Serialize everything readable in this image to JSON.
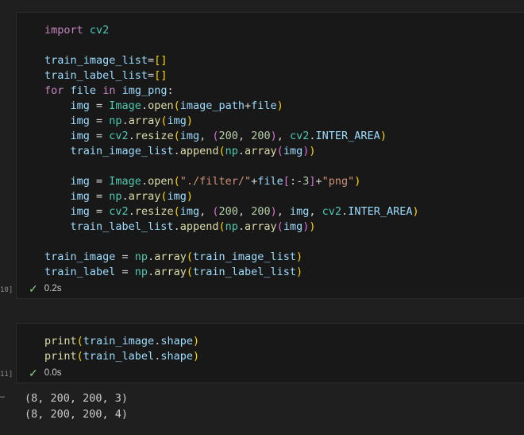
{
  "cells": [
    {
      "execution_label": "10]",
      "status": {
        "check_icon": "check-icon",
        "time": "0.2s"
      },
      "code_lines": [
        [
          [
            "kw",
            "import"
          ],
          [
            "op",
            " "
          ],
          [
            "mod",
            "cv2"
          ]
        ],
        [],
        [
          [
            "v",
            "train_image_list"
          ],
          [
            "op",
            "="
          ],
          [
            "p1",
            "[]"
          ]
        ],
        [
          [
            "v",
            "train_label_list"
          ],
          [
            "op",
            "="
          ],
          [
            "p1",
            "[]"
          ]
        ],
        [
          [
            "kw",
            "for"
          ],
          [
            "op",
            " "
          ],
          [
            "v",
            "file"
          ],
          [
            "op",
            " "
          ],
          [
            "kw",
            "in"
          ],
          [
            "op",
            " "
          ],
          [
            "v",
            "img_png"
          ],
          [
            "op",
            ":"
          ]
        ],
        [
          [
            "op",
            "    "
          ],
          [
            "v",
            "img"
          ],
          [
            "op",
            " = "
          ],
          [
            "cls",
            "Image"
          ],
          [
            "op",
            "."
          ],
          [
            "fn",
            "open"
          ],
          [
            "p1",
            "("
          ],
          [
            "v",
            "image_path"
          ],
          [
            "op",
            "+"
          ],
          [
            "v",
            "file"
          ],
          [
            "p1",
            ")"
          ]
        ],
        [
          [
            "op",
            "    "
          ],
          [
            "v",
            "img"
          ],
          [
            "op",
            " = "
          ],
          [
            "mod",
            "np"
          ],
          [
            "op",
            "."
          ],
          [
            "fn",
            "array"
          ],
          [
            "p1",
            "("
          ],
          [
            "v",
            "img"
          ],
          [
            "p1",
            ")"
          ]
        ],
        [
          [
            "op",
            "    "
          ],
          [
            "v",
            "img"
          ],
          [
            "op",
            " = "
          ],
          [
            "mod",
            "cv2"
          ],
          [
            "op",
            "."
          ],
          [
            "fn",
            "resize"
          ],
          [
            "p1",
            "("
          ],
          [
            "v",
            "img"
          ],
          [
            "op",
            ", "
          ],
          [
            "p2",
            "("
          ],
          [
            "num",
            "200"
          ],
          [
            "op",
            ", "
          ],
          [
            "num",
            "200"
          ],
          [
            "p2",
            ")"
          ],
          [
            "op",
            ", "
          ],
          [
            "mod",
            "cv2"
          ],
          [
            "op",
            "."
          ],
          [
            "v",
            "INTER_AREA"
          ],
          [
            "p1",
            ")"
          ]
        ],
        [
          [
            "op",
            "    "
          ],
          [
            "v",
            "train_image_list"
          ],
          [
            "op",
            "."
          ],
          [
            "fn",
            "append"
          ],
          [
            "p1",
            "("
          ],
          [
            "mod",
            "np"
          ],
          [
            "op",
            "."
          ],
          [
            "fn",
            "array"
          ],
          [
            "p2",
            "("
          ],
          [
            "v",
            "img"
          ],
          [
            "p2",
            ")"
          ],
          [
            "p1",
            ")"
          ]
        ],
        [],
        [
          [
            "op",
            "    "
          ],
          [
            "v",
            "img"
          ],
          [
            "op",
            " = "
          ],
          [
            "cls",
            "Image"
          ],
          [
            "op",
            "."
          ],
          [
            "fn",
            "open"
          ],
          [
            "p1",
            "("
          ],
          [
            "str",
            "\"./filter/\""
          ],
          [
            "op",
            "+"
          ],
          [
            "v",
            "file"
          ],
          [
            "p2",
            "["
          ],
          [
            "op",
            ":-"
          ],
          [
            "num",
            "3"
          ],
          [
            "p2",
            "]"
          ],
          [
            "op",
            "+"
          ],
          [
            "str",
            "\"png\""
          ],
          [
            "p1",
            ")"
          ]
        ],
        [
          [
            "op",
            "    "
          ],
          [
            "v",
            "img"
          ],
          [
            "op",
            " = "
          ],
          [
            "mod",
            "np"
          ],
          [
            "op",
            "."
          ],
          [
            "fn",
            "array"
          ],
          [
            "p1",
            "("
          ],
          [
            "v",
            "img"
          ],
          [
            "p1",
            ")"
          ]
        ],
        [
          [
            "op",
            "    "
          ],
          [
            "v",
            "img"
          ],
          [
            "op",
            " = "
          ],
          [
            "mod",
            "cv2"
          ],
          [
            "op",
            "."
          ],
          [
            "fn",
            "resize"
          ],
          [
            "p1",
            "("
          ],
          [
            "v",
            "img"
          ],
          [
            "op",
            ", "
          ],
          [
            "p2",
            "("
          ],
          [
            "num",
            "200"
          ],
          [
            "op",
            ", "
          ],
          [
            "num",
            "200"
          ],
          [
            "p2",
            ")"
          ],
          [
            "op",
            ", "
          ],
          [
            "v",
            "img"
          ],
          [
            "op",
            ", "
          ],
          [
            "mod",
            "cv2"
          ],
          [
            "op",
            "."
          ],
          [
            "v",
            "INTER_AREA"
          ],
          [
            "p1",
            ")"
          ]
        ],
        [
          [
            "op",
            "    "
          ],
          [
            "v",
            "train_label_list"
          ],
          [
            "op",
            "."
          ],
          [
            "fn",
            "append"
          ],
          [
            "p1",
            "("
          ],
          [
            "mod",
            "np"
          ],
          [
            "op",
            "."
          ],
          [
            "fn",
            "array"
          ],
          [
            "p2",
            "("
          ],
          [
            "v",
            "img"
          ],
          [
            "p2",
            ")"
          ],
          [
            "p1",
            ")"
          ]
        ],
        [],
        [
          [
            "v",
            "train_image"
          ],
          [
            "op",
            " = "
          ],
          [
            "mod",
            "np"
          ],
          [
            "op",
            "."
          ],
          [
            "fn",
            "array"
          ],
          [
            "p1",
            "("
          ],
          [
            "v",
            "train_image_list"
          ],
          [
            "p1",
            ")"
          ]
        ],
        [
          [
            "v",
            "train_label"
          ],
          [
            "op",
            " = "
          ],
          [
            "mod",
            "np"
          ],
          [
            "op",
            "."
          ],
          [
            "fn",
            "array"
          ],
          [
            "p1",
            "("
          ],
          [
            "v",
            "train_label_list"
          ],
          [
            "p1",
            ")"
          ]
        ]
      ]
    },
    {
      "execution_label": "11]",
      "status": {
        "check_icon": "check-icon",
        "time": "0.0s"
      },
      "code_lines": [
        [
          [
            "fn",
            "print"
          ],
          [
            "p1",
            "("
          ],
          [
            "v",
            "train_image"
          ],
          [
            "op",
            "."
          ],
          [
            "v",
            "shape"
          ],
          [
            "p1",
            ")"
          ]
        ],
        [
          [
            "fn",
            "print"
          ],
          [
            "p1",
            "("
          ],
          [
            "v",
            "train_label"
          ],
          [
            "op",
            "."
          ],
          [
            "v",
            "shape"
          ],
          [
            "p1",
            ")"
          ]
        ]
      ]
    }
  ],
  "output": {
    "marker": "…",
    "lines": [
      "(8, 200, 200, 3)",
      "(8, 200, 200, 4)"
    ]
  },
  "colors": {
    "background": "#1f1f1f",
    "cell_background": "#181818",
    "keyword": "#c586c0",
    "module": "#4ec9b0",
    "variable": "#9cdcfe",
    "function": "#dcdcaa",
    "number": "#b5cea8",
    "string": "#ce9178",
    "bracket_level1": "#ffd700",
    "bracket_level2": "#da70d6",
    "success_check": "#89d185"
  }
}
